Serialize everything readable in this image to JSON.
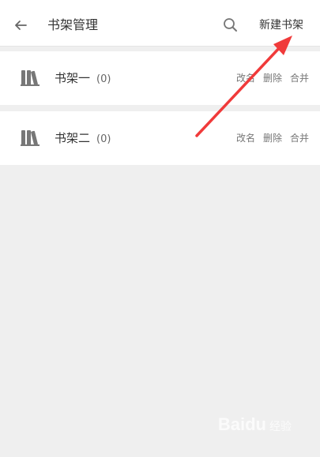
{
  "header": {
    "back_icon": "arrow-left-icon",
    "title": "书架管理",
    "search_icon": "search-icon",
    "new_shelf_label": "新建书架"
  },
  "shelves": [
    {
      "name": "书架一",
      "count": "(0)",
      "rename": "改名",
      "delete": "删除",
      "merge": "合并"
    },
    {
      "name": "书架二",
      "count": "(0)",
      "rename": "改名",
      "delete": "删除",
      "merge": "合并"
    }
  ],
  "annotation": {
    "color": "#f03a3a"
  },
  "watermark": {
    "brand": "Baidu",
    "sub": "经验"
  },
  "colors": {
    "background": "#efefef",
    "card": "#ffffff",
    "text": "#333333",
    "muted": "#777777"
  }
}
